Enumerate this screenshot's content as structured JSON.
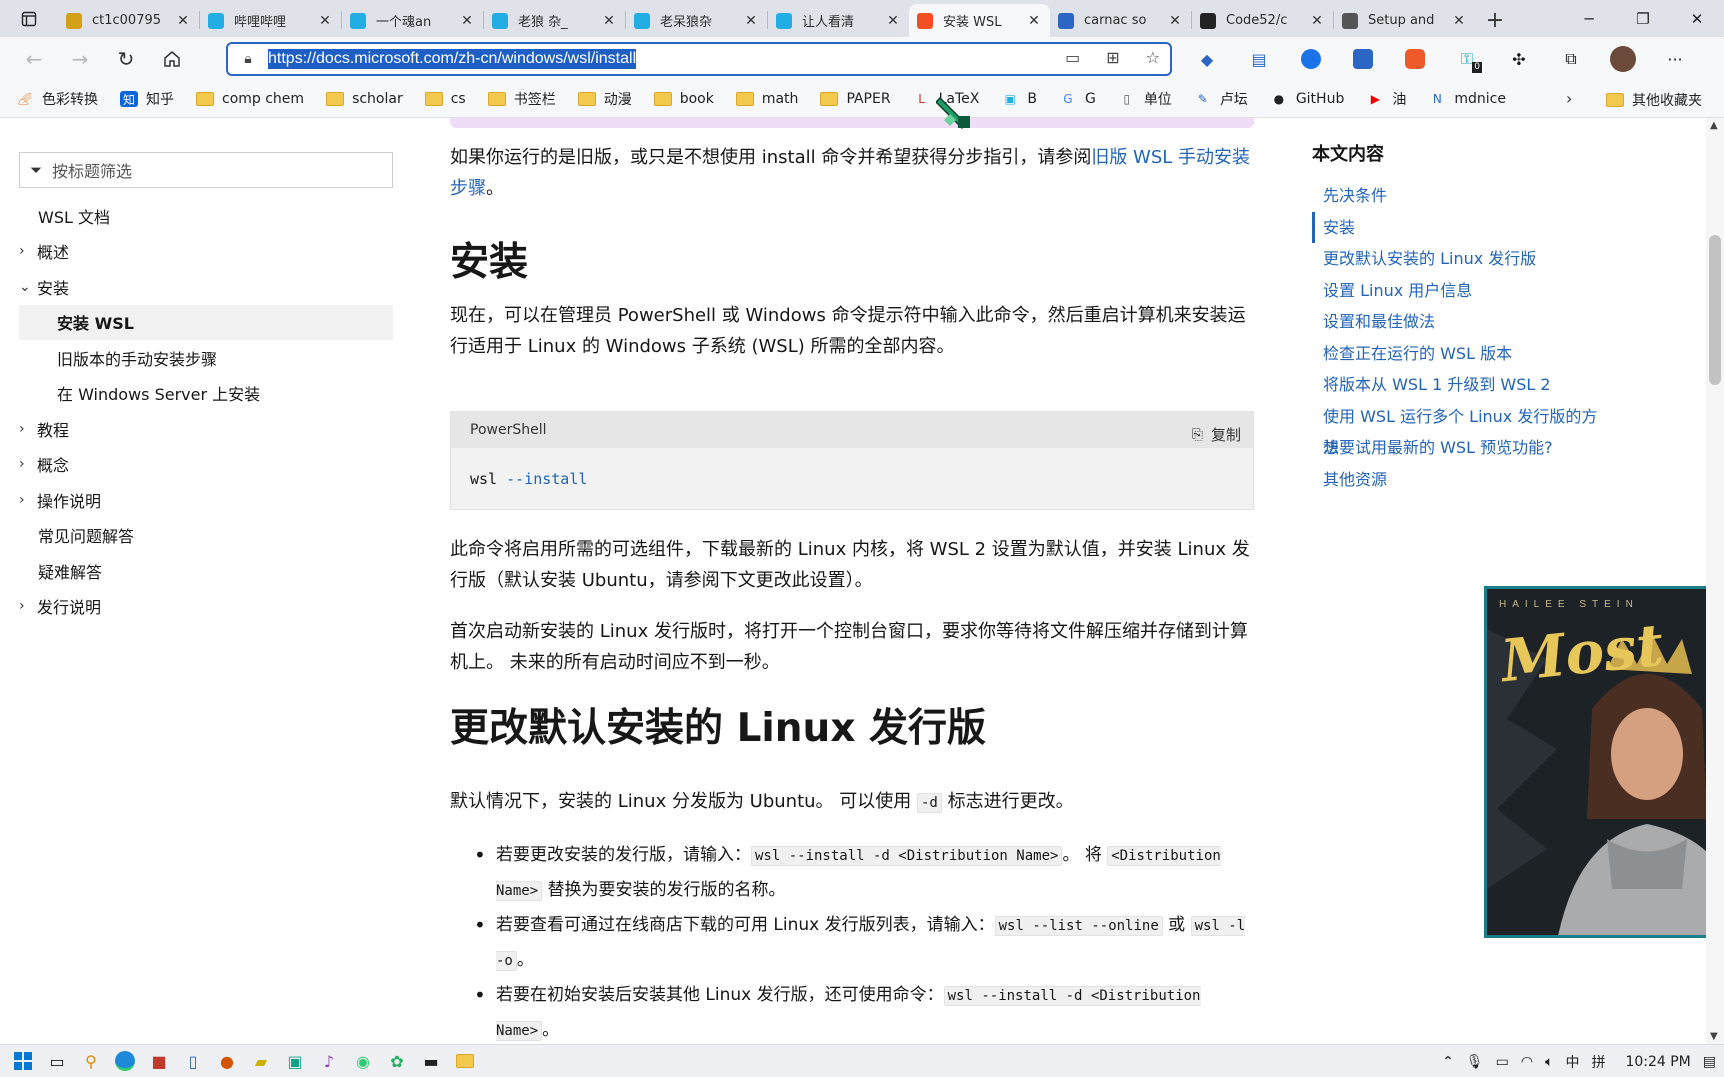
{
  "browser": {
    "tabs": [
      {
        "title": "ct1c00795",
        "icon_color": "#d4a017"
      },
      {
        "title": "哔哩哔哩",
        "icon_color": "#23ade5"
      },
      {
        "title": "一个魂an",
        "icon_color": "#23ade5"
      },
      {
        "title": "老狼 杂_",
        "icon_color": "#23ade5"
      },
      {
        "title": "老呆狼杂",
        "icon_color": "#23ade5"
      },
      {
        "title": "让人看清",
        "icon_color": "#23ade5"
      },
      {
        "title": "安装 WSL",
        "icon_color": "#f25022",
        "active": true
      },
      {
        "title": "carnac so",
        "icon_color": "#2c66c4"
      },
      {
        "title": "Code52/c",
        "icon_color": "#222222"
      },
      {
        "title": "Setup and",
        "icon_color": "#555555"
      }
    ],
    "url": "https://docs.microsoft.com/zh-cn/windows/wsl/install",
    "favorites": [
      {
        "label": "色彩转换",
        "icon": "rainbow-icon"
      },
      {
        "label": "知乎",
        "icon": "zhihu-icon"
      },
      {
        "label": "comp chem",
        "icon": "folder-icon"
      },
      {
        "label": "scholar",
        "icon": "folder-icon"
      },
      {
        "label": "cs",
        "icon": "folder-icon"
      },
      {
        "label": "书签栏",
        "icon": "folder-icon"
      },
      {
        "label": "动漫",
        "icon": "folder-icon"
      },
      {
        "label": "book",
        "icon": "folder-icon"
      },
      {
        "label": "math",
        "icon": "folder-icon"
      },
      {
        "label": "PAPER",
        "icon": "folder-icon"
      },
      {
        "label": "LaTeX",
        "icon": "latex-icon"
      },
      {
        "label": "B",
        "icon": "bilibili-icon"
      },
      {
        "label": "G",
        "icon": "google-icon"
      },
      {
        "label": "单位",
        "icon": "page-icon"
      },
      {
        "label": "卢坛",
        "icon": "forum-icon"
      },
      {
        "label": "GitHub",
        "icon": "github-icon"
      },
      {
        "label": "油",
        "icon": "youtube-icon"
      },
      {
        "label": "mdnice",
        "icon": "mdnice-icon"
      }
    ],
    "other_favorites": "其他收藏夹",
    "extension_badge": "0"
  },
  "leftnav": {
    "filter_placeholder": "按标题筛选",
    "items": [
      {
        "label": "WSL 文档",
        "level": 1,
        "chevron": ""
      },
      {
        "label": "概述",
        "level": 1,
        "chevron": "›"
      },
      {
        "label": "安装",
        "level": 1,
        "chevron": "⌄"
      },
      {
        "label": "安装 WSL",
        "level": 2,
        "selected": true
      },
      {
        "label": "旧版本的手动安装步骤",
        "level": 2
      },
      {
        "label": "在 Windows Server 上安装",
        "level": 2
      },
      {
        "label": "教程",
        "level": 1,
        "chevron": "›"
      },
      {
        "label": "概念",
        "level": 1,
        "chevron": "›"
      },
      {
        "label": "操作说明",
        "level": 1,
        "chevron": "›"
      },
      {
        "label": "常见问题解答",
        "level": 1,
        "chevron": ""
      },
      {
        "label": "疑难解答",
        "level": 1,
        "chevron": ""
      },
      {
        "label": "发行说明",
        "level": 1,
        "chevron": "›"
      }
    ]
  },
  "main": {
    "intro_text": "如果你运行的是旧版，或只是不想使用 install 命令并希望获得分步指引，请参阅",
    "intro_link": "旧版 WSL 手动安装步骤",
    "intro_end": "。",
    "h_install": "安装",
    "install_para": "现在，可以在管理员 PowerShell 或 Windows 命令提示符中输入此命令，然后重启计算机来安装运行适用于 Linux 的 Windows 子系统 (WSL) 所需的全部内容。",
    "code_lang": "PowerShell",
    "copy_label": "复制",
    "code_cmd": "wsl",
    "code_flag": "--install",
    "para2": "此命令将启用所需的可选组件，下载最新的 Linux 内核，将 WSL 2 设置为默认值，并安装 Linux 发行版（默认安装 Ubuntu，请参阅下文更改此设置）。",
    "para3": "首次启动新安装的 Linux 发行版时，将打开一个控制台窗口，要求你等待将文件解压缩并存储到计算机上。 未来的所有启动时间应不到一秒。",
    "h_change": "更改默认安装的 Linux 发行版",
    "para4_a": "默认情况下，安装的 Linux 分发版为 Ubuntu。 可以使用 ",
    "para4_code": "-d",
    "para4_b": " 标志进行更改。",
    "bullet1_a": "若要更改安装的发行版，请输入：",
    "bullet1_code": "wsl --install -d <Distribution Name>",
    "bullet1_b": "。 将 ",
    "bullet1_code2": "<Distribution Name>",
    "bullet1_c": " 替换为要安装的发行版的名称。",
    "bullet2_a": "若要查看可通过在线商店下载的可用 Linux 发行版列表，请输入：",
    "bullet2_code": "wsl --list --online",
    "bullet2_b": " 或 ",
    "bullet2_code2": "wsl -l -o",
    "bullet2_c": "。",
    "bullet3_a": "若要在初始安装后安装其他 Linux 发行版，还可使用命令：",
    "bullet3_code": "wsl --install -d <Distribution Name>",
    "bullet3_b": "。"
  },
  "toc": {
    "title": "本文内容",
    "items": [
      {
        "label": "先决条件"
      },
      {
        "label": "安装",
        "active": true
      },
      {
        "label": "更改默认安装的 Linux 发行版"
      },
      {
        "label": "设置 Linux 用户信息"
      },
      {
        "label": "设置和最佳做法"
      },
      {
        "label": "检查正在运行的 WSL 版本"
      },
      {
        "label": "将版本从 WSL 1 升级到 WSL 2"
      },
      {
        "label": "使用 WSL 运行多个 Linux 发行版的方法"
      },
      {
        "label": "想要试用最新的 WSL 预览功能?"
      },
      {
        "label": "其他资源"
      }
    ]
  },
  "video": {
    "caption": "HAILEE STEIN",
    "title": "Most"
  },
  "taskbar": {
    "ime": "中",
    "ime2": "拼",
    "time": "10:24 PM"
  }
}
